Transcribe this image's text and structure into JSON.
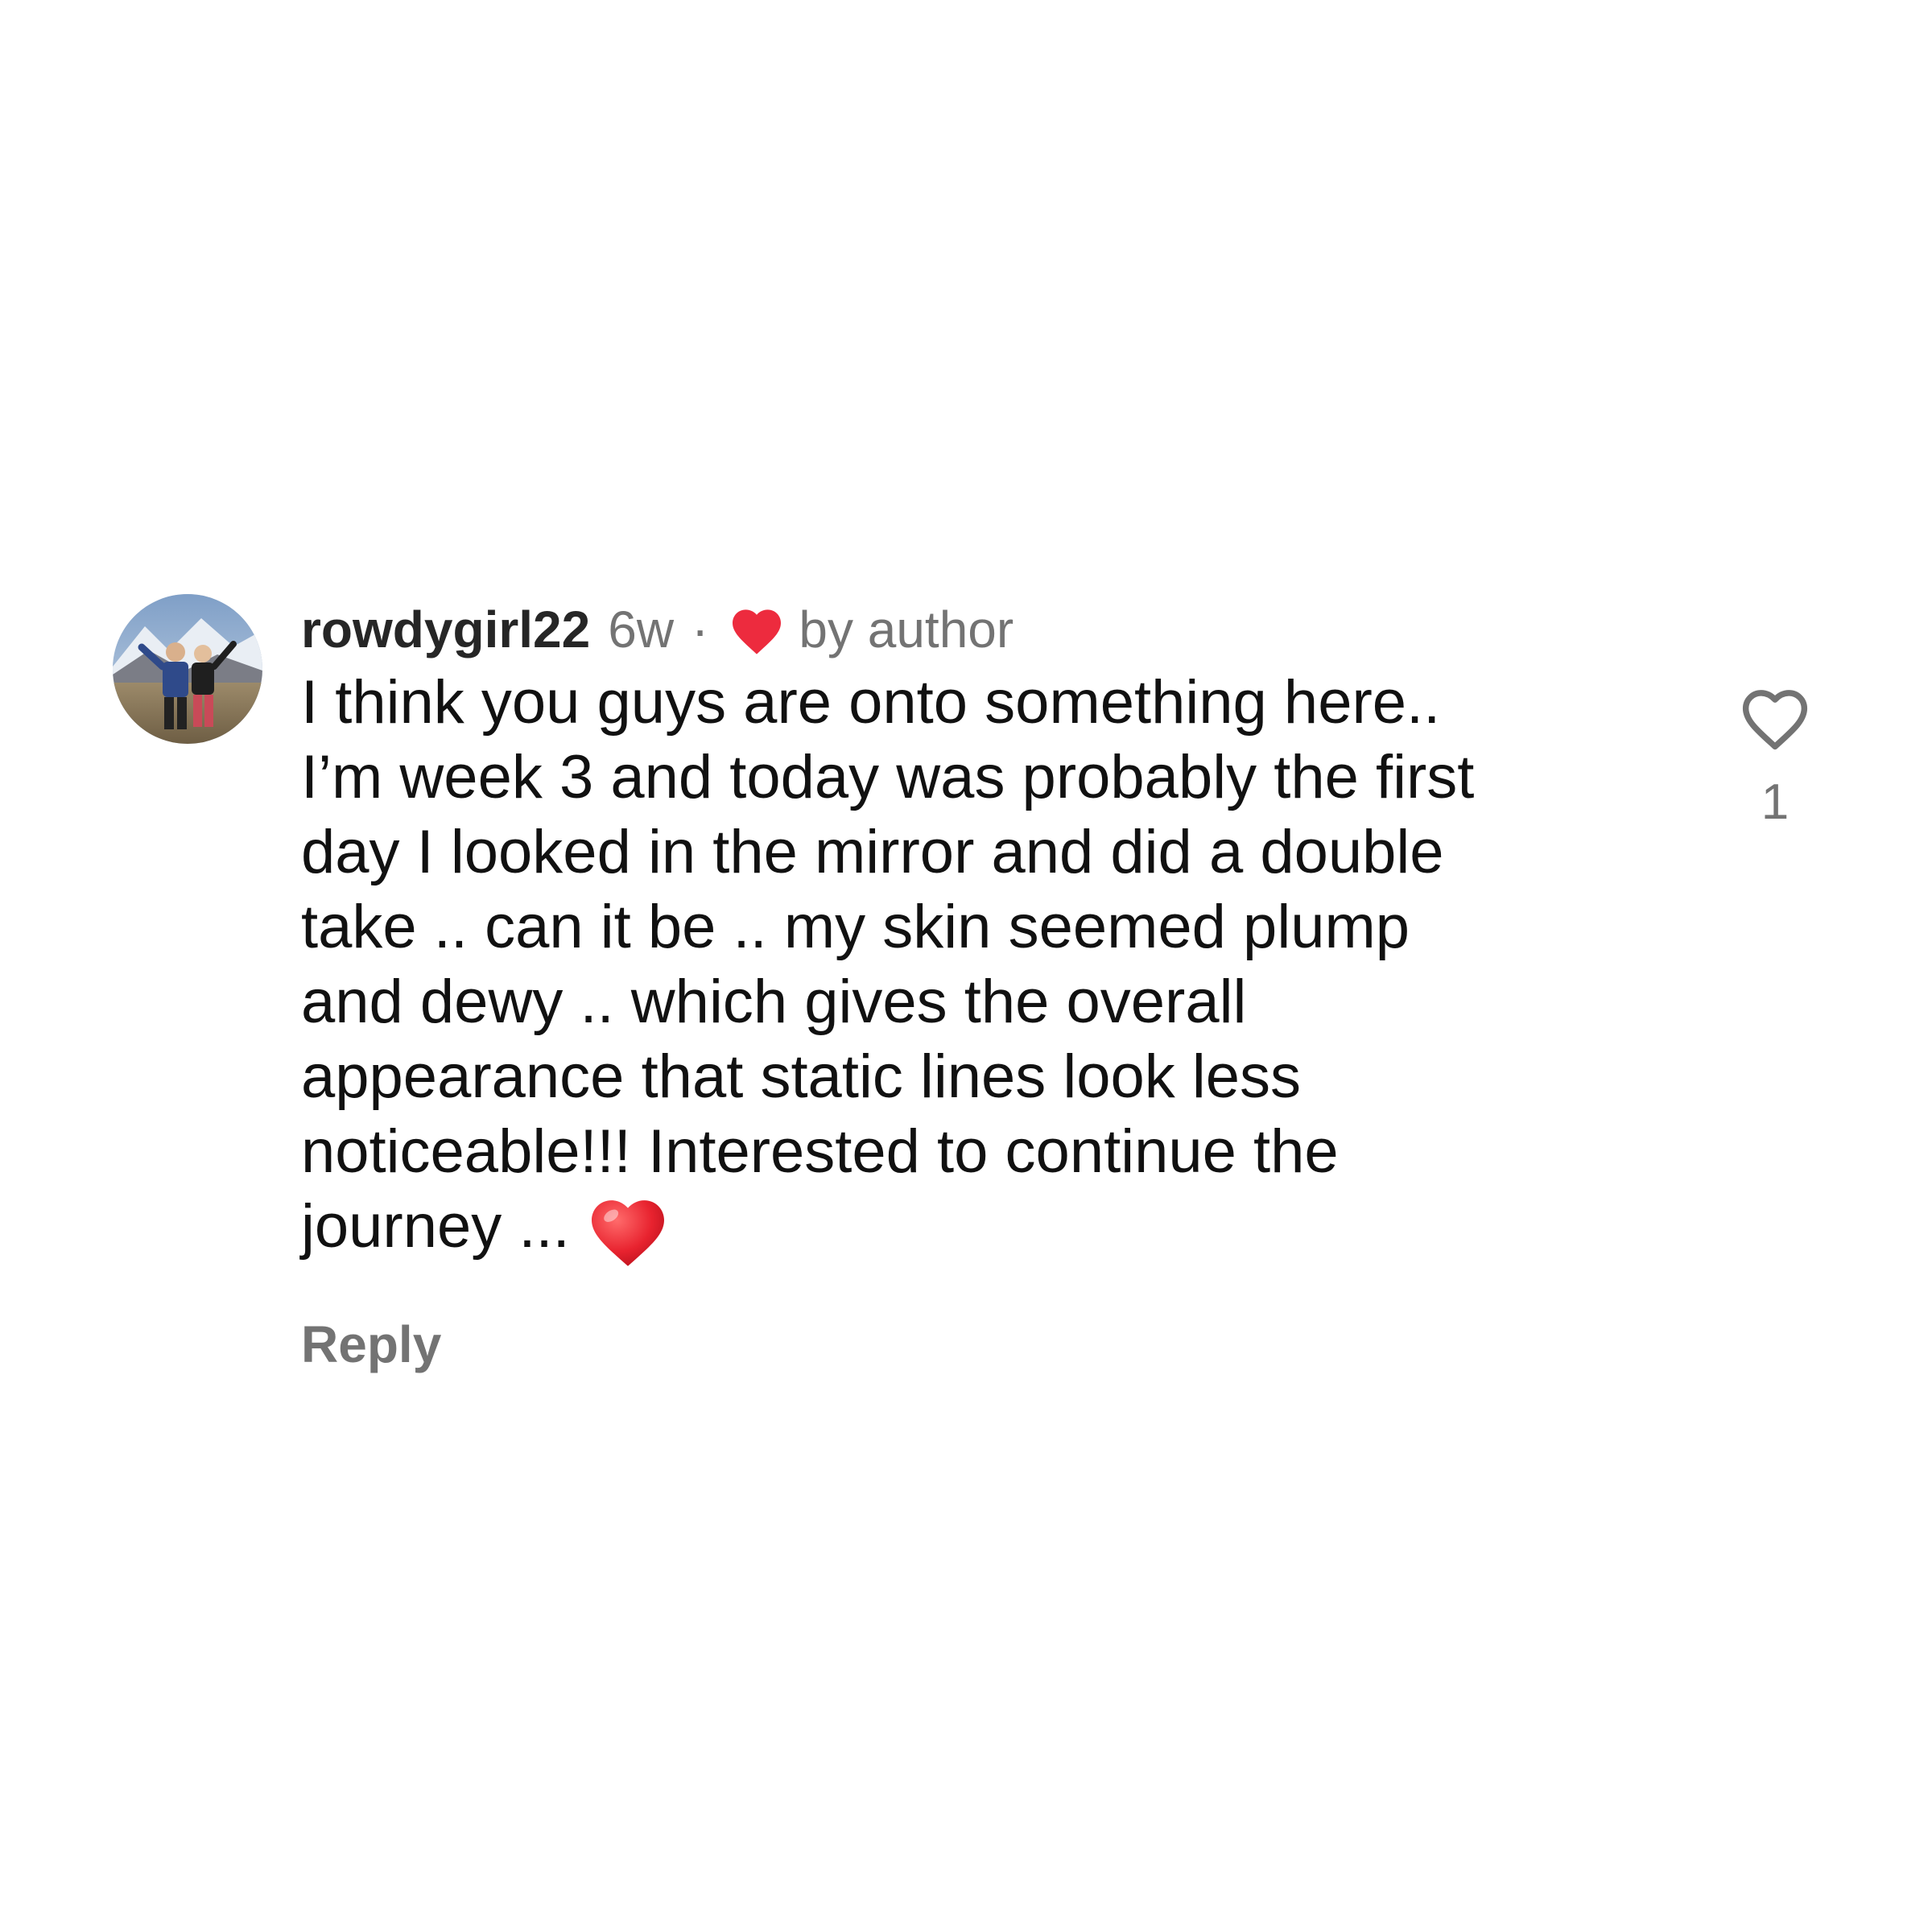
{
  "comment": {
    "username": "rowdygirl22",
    "time_ago": "6w",
    "separator": "·",
    "liked_by_author_label": "by author",
    "text": "I think you guys are onto something here..\nI’m week 3 and today was probably the first\nday I looked in the mirror and did a double\ntake .. can it be .. my skin seemed plump\nand dewy .. which gives the overall\nappearance that static lines look less\nnoticeable!!! Interested to continue the\njourney ...",
    "reply_label": "Reply",
    "like_count": "1",
    "icons": {
      "author_like": "heart-filled-icon",
      "emoji": "red-heart-emoji",
      "like_button": "heart-outline-icon"
    },
    "colors": {
      "heart_red": "#ed2b3e",
      "secondary_text": "#737373",
      "primary_text": "#111111"
    }
  }
}
